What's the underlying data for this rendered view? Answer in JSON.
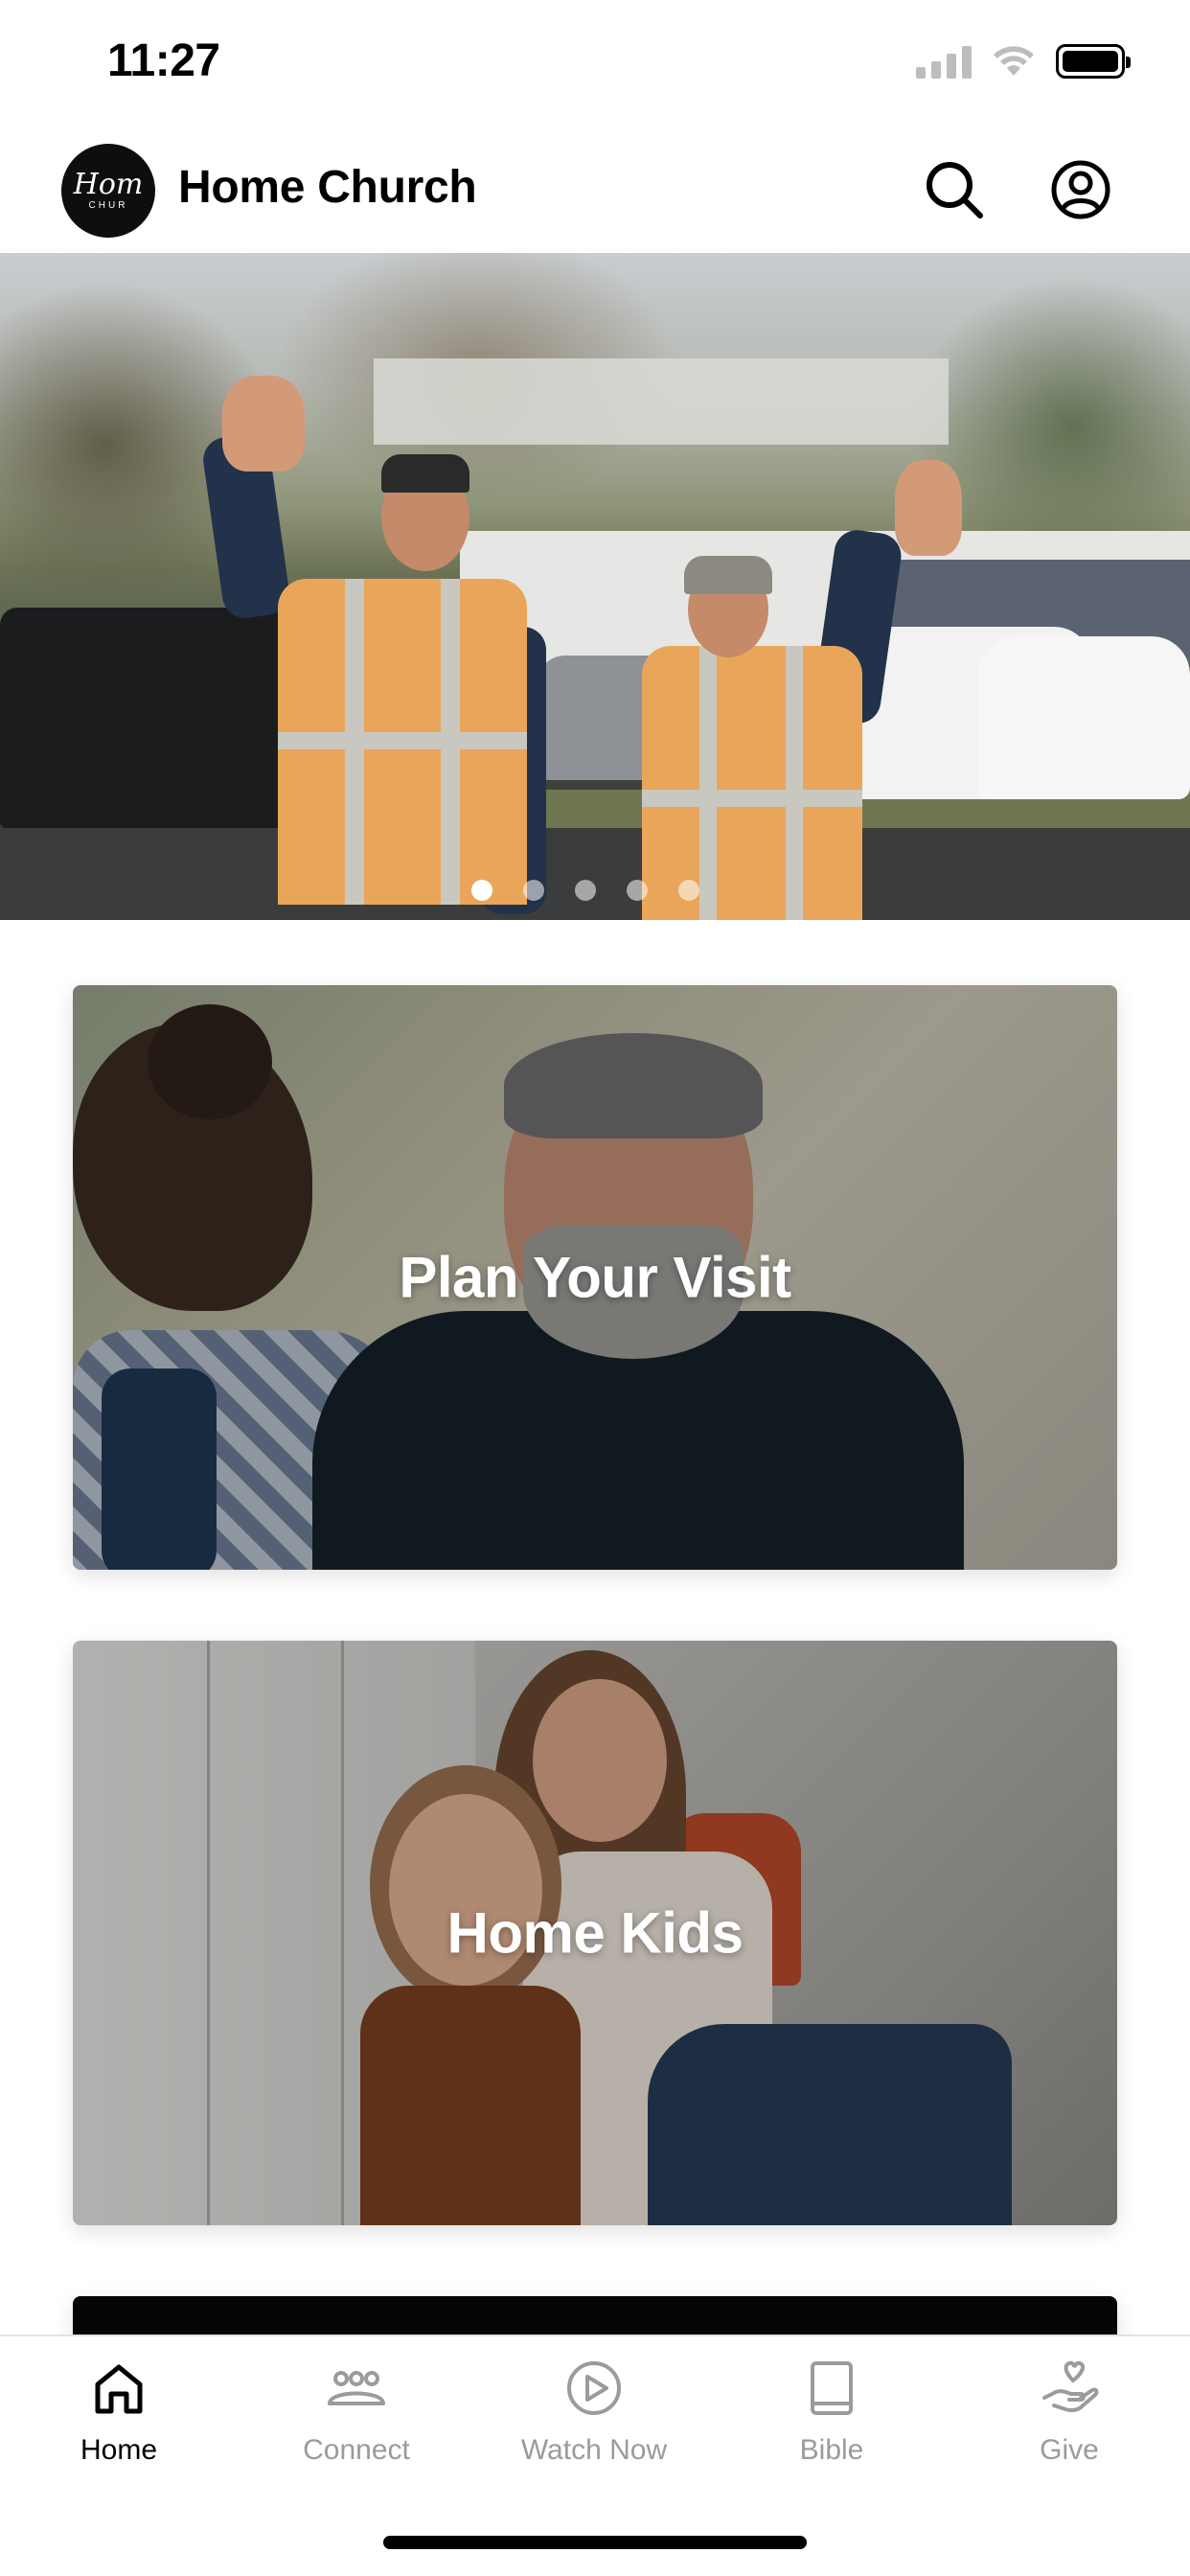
{
  "status_bar": {
    "time": "11:27"
  },
  "header": {
    "logo_script": "Hom",
    "logo_small": "CHUR",
    "title": "Home Church",
    "search_icon": "search-icon",
    "profile_icon": "user-circle-icon"
  },
  "hero": {
    "slide_count": 5,
    "active_slide": 1
  },
  "cards": [
    {
      "title": "Plan Your Visit"
    },
    {
      "title": "Home Kids"
    }
  ],
  "tab_bar": {
    "items": [
      {
        "label": "Home",
        "icon": "home-icon",
        "active": true
      },
      {
        "label": "Connect",
        "icon": "people-group-icon",
        "active": false
      },
      {
        "label": "Watch Now",
        "icon": "play-circle-icon",
        "active": false
      },
      {
        "label": "Bible",
        "icon": "book-icon",
        "active": false
      },
      {
        "label": "Give",
        "icon": "hand-heart-icon",
        "active": false
      }
    ]
  },
  "colors": {
    "active_tab": "#000000",
    "inactive_tab": "#9b9b9b"
  }
}
